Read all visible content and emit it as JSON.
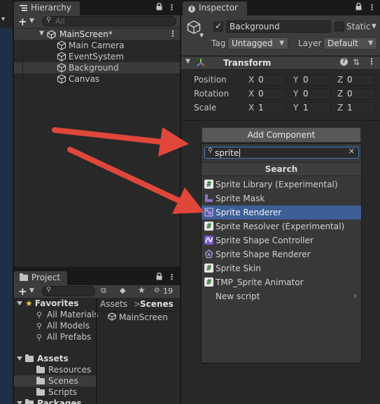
{
  "colors": {
    "accent_select": "#3e5f96",
    "arrow": "#e0463a",
    "panel_bg": "#282828",
    "search_focus": "#3d7ac7"
  },
  "hierarchy": {
    "tab_label": "Hierarchy",
    "search_placeholder": "All",
    "scene_name": "MainScreen*",
    "items": [
      {
        "label": "Main Camera",
        "icon": "gameobject-cube-icon"
      },
      {
        "label": "EventSystem",
        "icon": "gameobject-cube-icon"
      },
      {
        "label": "Background",
        "icon": "gameobject-cube-icon"
      },
      {
        "label": "Canvas",
        "icon": "gameobject-cube-icon"
      }
    ]
  },
  "project": {
    "tab_label": "Project",
    "hidden_count": "19",
    "favorites_label": "Favorites",
    "favorites": [
      "All Materials",
      "All Models",
      "All Prefabs"
    ],
    "assets_label": "Assets",
    "asset_folders": [
      "Resources",
      "Scenes",
      "Scripts"
    ],
    "packages_label": "Packages",
    "breadcrumb": {
      "root": "Assets",
      "separator": ">",
      "current": "Scenes"
    },
    "files": [
      "MainScreen"
    ]
  },
  "inspector": {
    "tab_label": "Inspector",
    "object_name": "Background",
    "static_label": "Static",
    "tag_label": "Tag",
    "tag_value": "Untagged",
    "layer_label": "Layer",
    "layer_value": "Default",
    "transform": {
      "title": "Transform",
      "rows": [
        {
          "label": "Position",
          "x": "0",
          "y": "0",
          "z": "0"
        },
        {
          "label": "Rotation",
          "x": "0",
          "y": "0",
          "z": "0"
        },
        {
          "label": "Scale",
          "x": "1",
          "y": "1",
          "z": "1"
        }
      ],
      "axis_labels": [
        "X",
        "Y",
        "Z"
      ]
    },
    "add_component_label": "Add Component",
    "popup": {
      "search_value": "sprite",
      "title": "Search",
      "items": [
        {
          "label": "Sprite Library (Experimental)",
          "icon": "script-hash-icon",
          "selected": false
        },
        {
          "label": "Sprite Mask",
          "icon": "sprite-mask-icon",
          "selected": false
        },
        {
          "label": "Sprite Renderer",
          "icon": "sprite-renderer-icon",
          "selected": true
        },
        {
          "label": "Sprite Resolver (Experimental)",
          "icon": "script-hash-icon",
          "selected": false
        },
        {
          "label": "Sprite Shape Controller",
          "icon": "sprite-shape-controller-icon",
          "selected": false
        },
        {
          "label": "Sprite Shape Renderer",
          "icon": "sprite-shape-renderer-icon",
          "selected": false
        },
        {
          "label": "Sprite Skin",
          "icon": "script-hash-icon",
          "selected": false
        },
        {
          "label": "TMP_Sprite Animator",
          "icon": "script-hash-icon",
          "selected": false
        }
      ],
      "new_script_label": "New script"
    }
  }
}
